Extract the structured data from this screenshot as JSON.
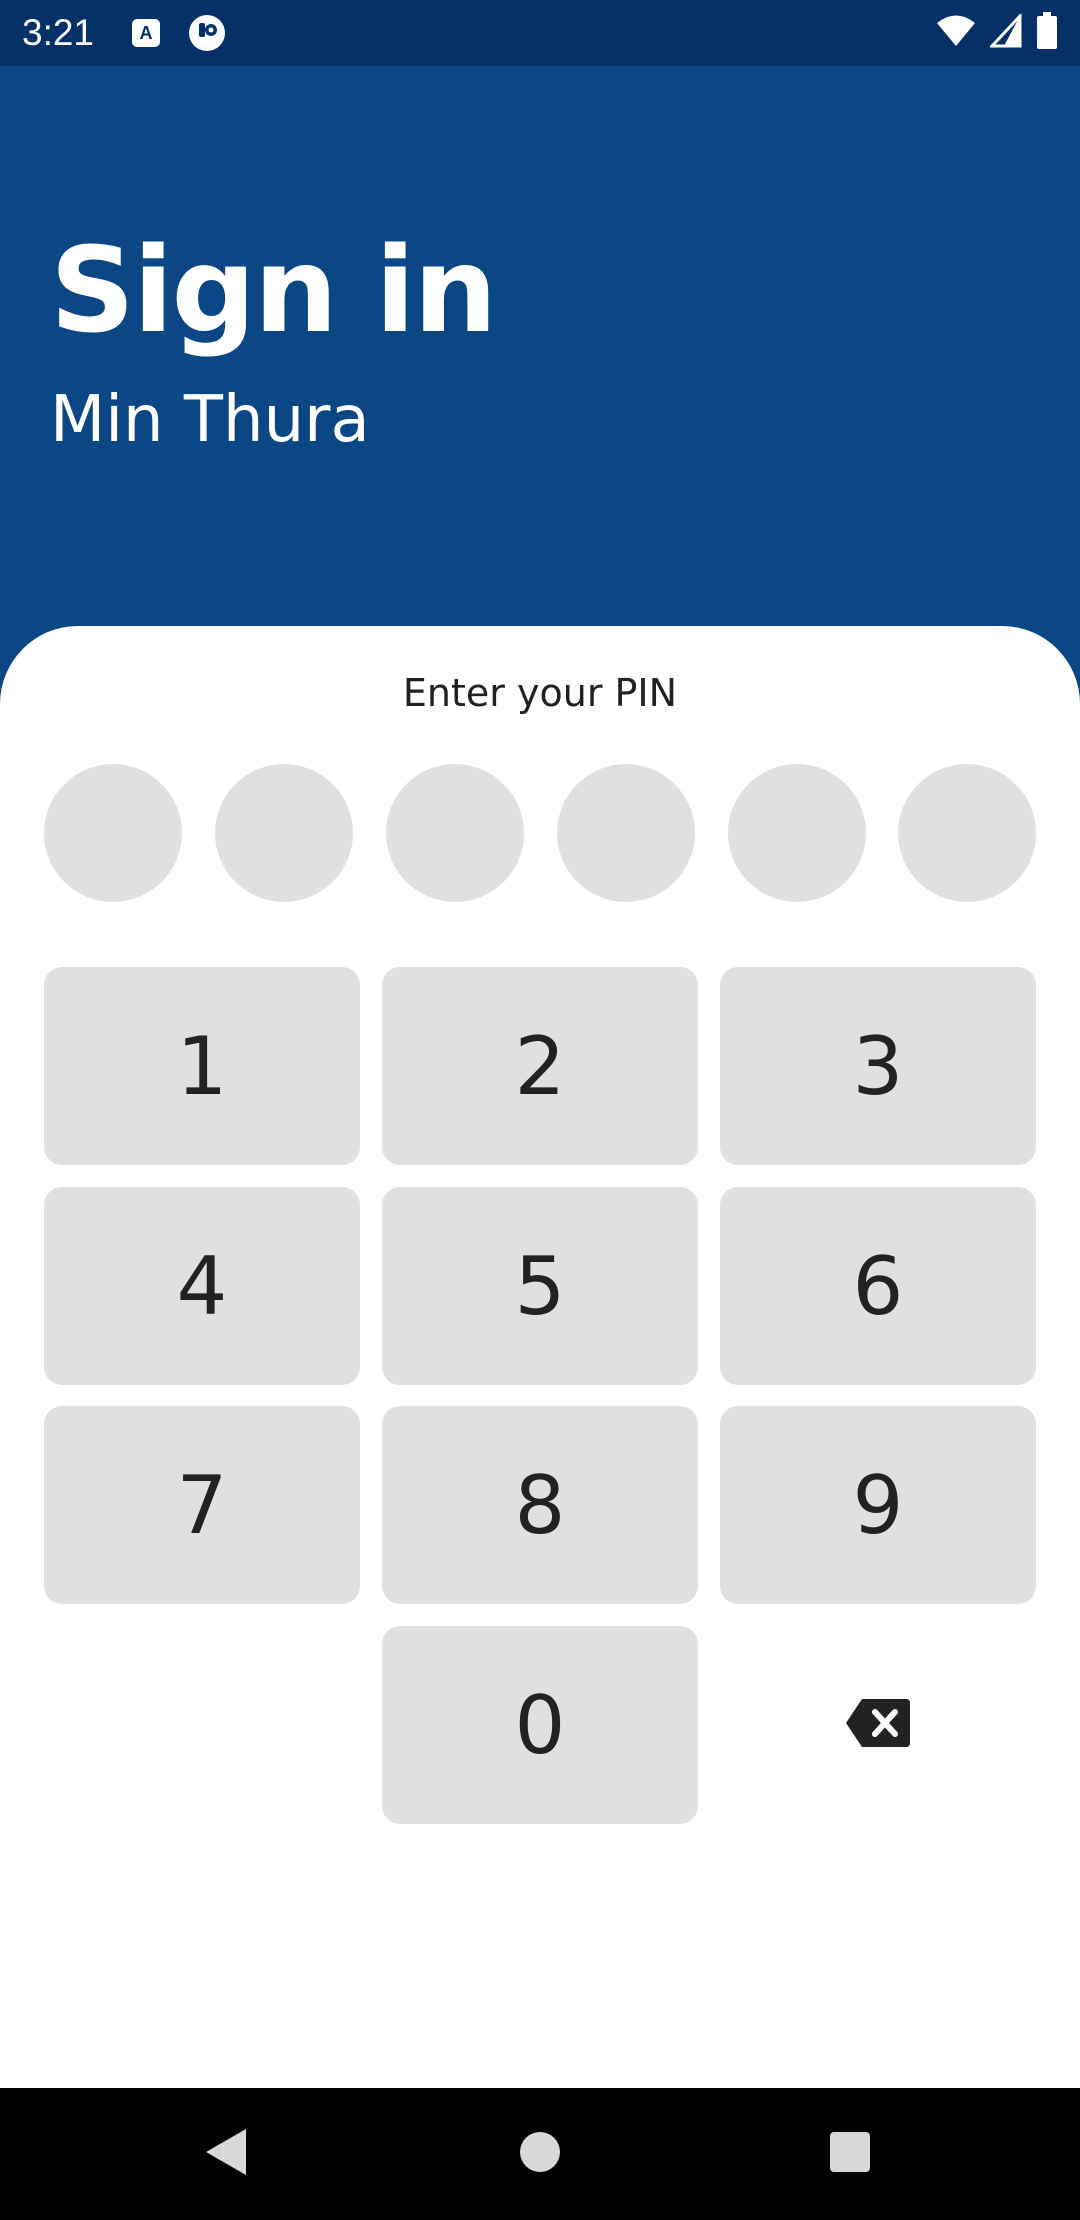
{
  "status_bar": {
    "time": "3:21",
    "app_icon_a_label": "A",
    "icons": [
      "app-a-icon",
      "app-badge-icon",
      "wifi-icon",
      "signal-icon",
      "battery-icon"
    ]
  },
  "header": {
    "title": "Sign in",
    "user_name": "Min Thura",
    "background_color": "#0a4784"
  },
  "pin": {
    "prompt": "Enter your PIN",
    "length": 6,
    "entered": 0
  },
  "keypad": {
    "keys": [
      "1",
      "2",
      "3",
      "4",
      "5",
      "6",
      "7",
      "8",
      "9",
      "0"
    ],
    "backspace_icon": "backspace-icon"
  },
  "nav_bar": {
    "icons": [
      "back-icon",
      "home-icon",
      "recents-icon"
    ]
  }
}
